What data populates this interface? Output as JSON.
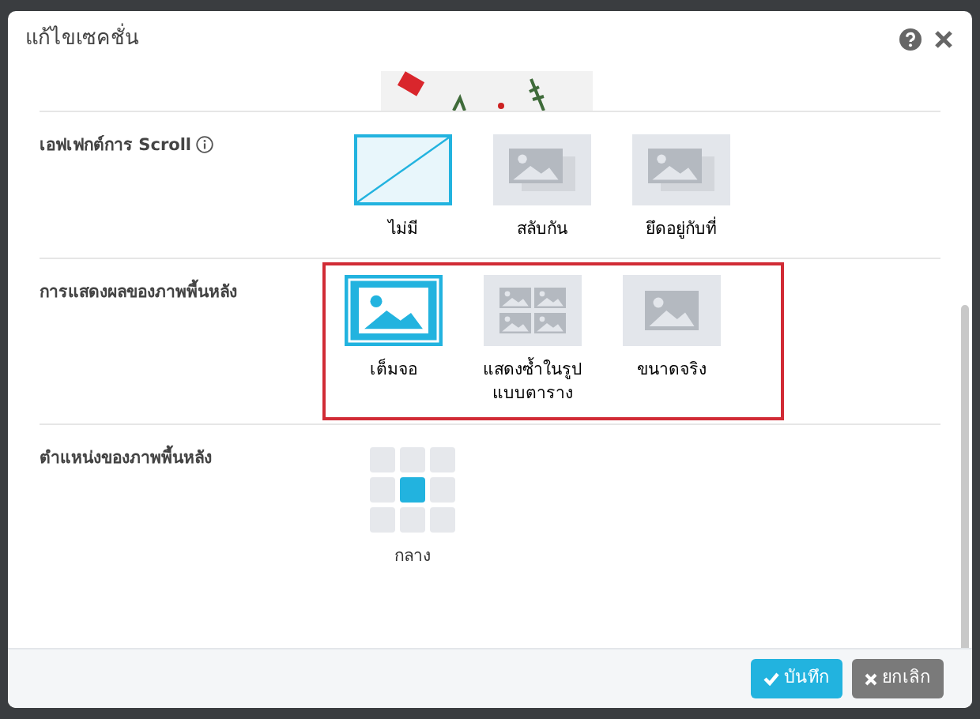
{
  "dialog": {
    "title": "แก้ไขเซคชั่น"
  },
  "sections": [
    {
      "label": "เอฟเฟกต์การ Scroll",
      "info": true,
      "highlighted": false,
      "options": [
        {
          "kind": "none",
          "label": "ไม่มี",
          "selected": true
        },
        {
          "kind": "swap",
          "label": "สลับกัน",
          "selected": false
        },
        {
          "kind": "fixed",
          "label": "ยึดอยู่กับที่",
          "selected": false
        }
      ]
    },
    {
      "label": "การแสดงผลของภาพพื้นหลัง",
      "info": false,
      "highlighted": true,
      "options": [
        {
          "kind": "fill",
          "label": "เต็มจอ",
          "selected": true
        },
        {
          "kind": "tile",
          "label": "แสดงซ้ำในรูปแบบตาราง",
          "selected": false
        },
        {
          "kind": "actual",
          "label": "ขนาดจริง",
          "selected": false
        }
      ]
    }
  ],
  "position": {
    "label": "ตำแหน่งของภาพพื้นหลัง",
    "cells": [
      {
        "selected": false
      },
      {
        "selected": false
      },
      {
        "selected": false
      },
      {
        "selected": false
      },
      {
        "selected": true
      },
      {
        "selected": false
      },
      {
        "selected": false
      },
      {
        "selected": false
      },
      {
        "selected": false
      }
    ],
    "caption": "กลาง"
  },
  "buttons": [
    {
      "kind": "save",
      "label": "บันทึก"
    },
    {
      "kind": "cancel",
      "label": "ยกเลิก"
    }
  ]
}
